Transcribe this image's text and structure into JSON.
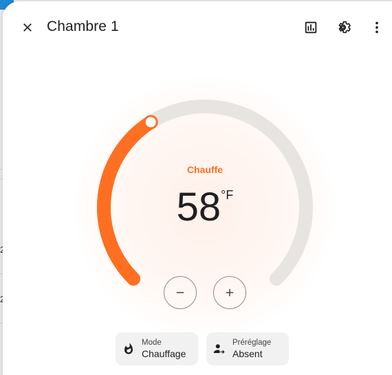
{
  "dialog": {
    "title": "Chambre 1"
  },
  "header": {
    "close_icon": "close-icon",
    "history_icon": "chart-box-icon",
    "settings_icon": "gear-icon",
    "more_icon": "dots-vertical-icon"
  },
  "thermostat": {
    "action": "Chauffe",
    "target_temperature": "58",
    "unit": "°F",
    "level_fraction": 0.38,
    "accent_color": "#ff6f22",
    "track_color": "#e8e4e1"
  },
  "controls": {
    "decrease_icon": "minus-icon",
    "increase_icon": "plus-icon"
  },
  "chips": [
    {
      "label": "Mode",
      "value": "Chauffage",
      "icon": "fire-icon"
    },
    {
      "label": "Préréglage",
      "value": "Absent",
      "icon": "account-arrow-icon"
    }
  ],
  "background": {
    "digit_a": "2",
    "digit_b": "2"
  }
}
